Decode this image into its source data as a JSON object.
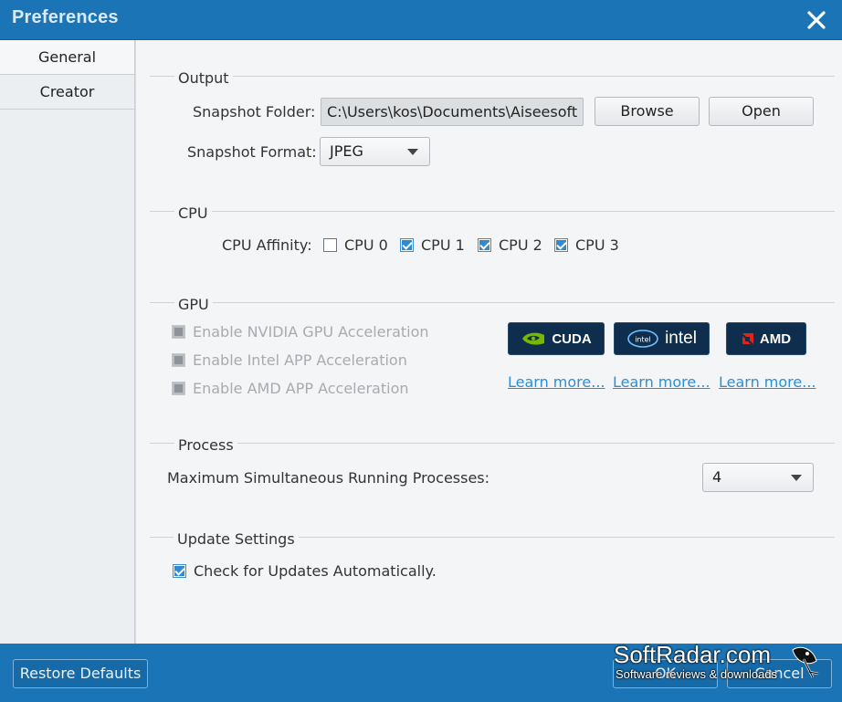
{
  "window": {
    "title": "Preferences"
  },
  "sidebar": {
    "items": [
      {
        "label": "General"
      },
      {
        "label": "Creator"
      }
    ]
  },
  "output": {
    "section_title": "Output",
    "snapshot_folder_label": "Snapshot Folder:",
    "snapshot_folder_value": "C:\\Users\\kos\\Documents\\Aiseesoft S",
    "browse_label": "Browse",
    "open_label": "Open",
    "snapshot_format_label": "Snapshot Format:",
    "snapshot_format_value": "JPEG"
  },
  "cpu": {
    "section_title": "CPU",
    "affinity_label": "CPU Affinity:",
    "cores": [
      {
        "label": "CPU 0",
        "checked": false
      },
      {
        "label": "CPU 1",
        "checked": true
      },
      {
        "label": "CPU 2",
        "checked": true
      },
      {
        "label": "CPU 3",
        "checked": true
      }
    ]
  },
  "gpu": {
    "section_title": "GPU",
    "options": [
      {
        "label": "Enable NVIDIA GPU Acceleration",
        "enabled": false
      },
      {
        "label": "Enable Intel APP Acceleration",
        "enabled": false
      },
      {
        "label": "Enable AMD APP Acceleration",
        "enabled": false
      }
    ],
    "vendors": [
      {
        "name": "CUDA",
        "icon": "nvidia-icon",
        "link": "Learn more..."
      },
      {
        "name": "intel",
        "icon": "intel-icon",
        "link": "Learn more..."
      },
      {
        "name": "AMD",
        "icon": "amd-icon",
        "link": "Learn more..."
      }
    ]
  },
  "process": {
    "section_title": "Process",
    "max_label": "Maximum Simultaneous Running Processes:",
    "max_value": "4"
  },
  "update": {
    "section_title": "Update Settings",
    "auto_check_label": "Check for Updates Automatically.",
    "auto_check": true
  },
  "footer": {
    "restore_label": "Restore Defaults",
    "ok_label": "OK",
    "cancel_label": "Cancel"
  },
  "watermark": {
    "main": "SoftRadar.com",
    "sub": "Software reviews & downloads"
  },
  "colors": {
    "titlebar": "#1b74b6",
    "accent": "#2e8ad1",
    "link": "#2a8fd6"
  }
}
